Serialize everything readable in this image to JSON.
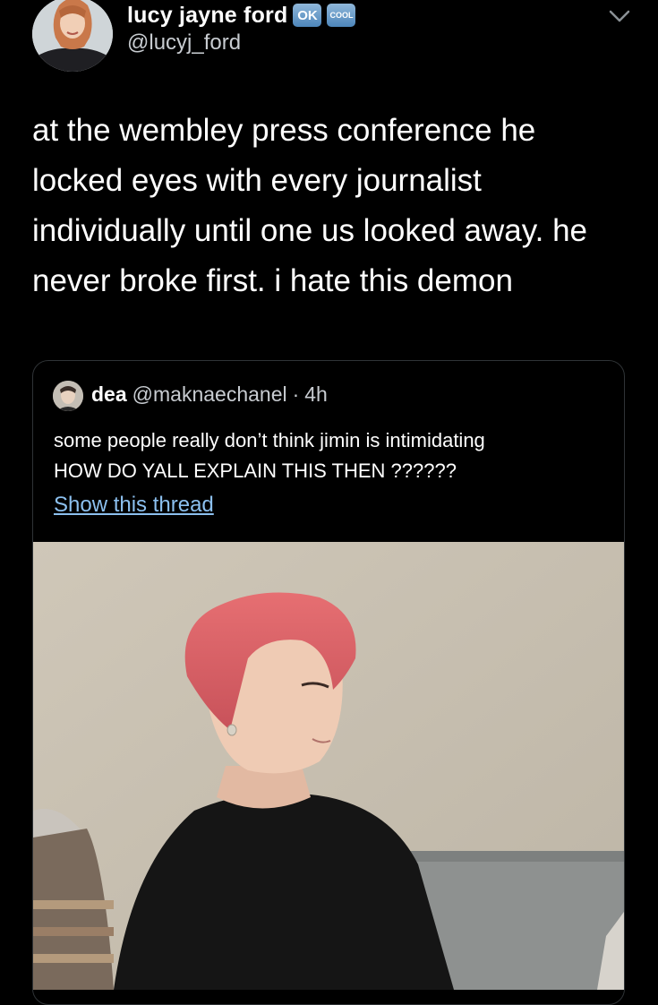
{
  "author": {
    "display_name": "lucy jayne ford",
    "badges": [
      "OK",
      "COOL"
    ],
    "handle": "@lucyj_ford"
  },
  "tweet": {
    "text": "at the wembley press conference he locked eyes with every journalist individually until one us looked away. he never broke first. i hate this demon"
  },
  "quoted_tweet": {
    "display_name": "dea",
    "handle": "@maknaechanel",
    "separator": "·",
    "time": "4h",
    "text_line1": "some people really don’t think jimin is intimidating",
    "text_line2": "HOW DO YALL EXPLAIN THIS THEN ??????",
    "show_thread_label": "Show this thread"
  },
  "icons": {
    "menu": "chevron-down-icon",
    "badge_ok": "ok-button-emoji-icon",
    "badge_cool": "cool-button-emoji-icon"
  },
  "colors": {
    "background": "#000000",
    "text": "#ffffff",
    "secondary_text": "#c8ccd1",
    "link": "#8cc0ef",
    "border": "#2f3336",
    "badge": "#5b8fc2"
  }
}
